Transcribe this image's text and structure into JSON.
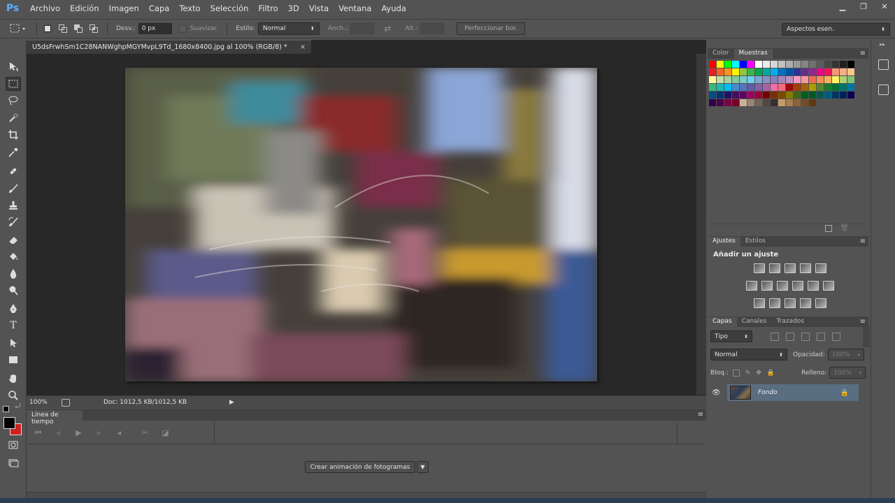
{
  "app": {
    "logo": "Ps"
  },
  "menu": [
    "Archivo",
    "Edición",
    "Imagen",
    "Capa",
    "Texto",
    "Selección",
    "Filtro",
    "3D",
    "Vista",
    "Ventana",
    "Ayuda"
  ],
  "window_controls": {
    "minimize": "▁",
    "restore": "❐",
    "close": "✕"
  },
  "options": {
    "feather_label": "Desv.:",
    "feather_value": "0 px",
    "antialias_label": "Suavizar",
    "style_label": "Estilo:",
    "style_value": "Normal",
    "width_label": "Anch.:",
    "height_label": "Alt.:",
    "refine_button": "Perfeccionar bor.",
    "workspace": "Aspectos esen."
  },
  "document": {
    "tab_title": "U5dsFrwhSm1C28NANWghpMGYMvpL9Td_1680x8400.jpg al 100% (RGB/8) *",
    "tab_close": "×"
  },
  "status": {
    "zoom": "100%",
    "doc_info": "Doc: 1012,5 KB/1012,5 KB",
    "arrow": "▶"
  },
  "timeline": {
    "tab": "Línea de tiempo",
    "create_button": "Crear animación de fotogramas",
    "menu": "≡",
    "dropdown_glyph": "▼"
  },
  "panels": {
    "color_tabs": [
      "Color",
      "Muestras"
    ],
    "adjust_tabs": [
      "Ajustes",
      "Estilos"
    ],
    "adjust_title": "Añadir un ajuste",
    "layers_tabs": [
      "Capas",
      "Canales",
      "Trazados"
    ],
    "kind_filter": "Tipo",
    "blend_mode": "Normal",
    "opacity_label": "Opacidad:",
    "opacity_value": "100%",
    "lock_label": "Bloq.:",
    "fill_label": "Relleno:",
    "fill_value": "100%",
    "layer_name": "Fondo",
    "menu": "≡"
  },
  "colors": {
    "ui_bg": "#535353",
    "canvas_bg": "#282828",
    "layer_selected": "#5a6e82",
    "foreground": "#000000",
    "background": "#d0201e"
  },
  "swatches": [
    "#ff0000",
    "#ffff00",
    "#00ff00",
    "#00ffff",
    "#0000ff",
    "#ff00ff",
    "#ffffff",
    "#ebebeb",
    "#d6d6d6",
    "#c2c2c2",
    "#adadad",
    "#999999",
    "#858585",
    "#707070",
    "#5c5c5c",
    "#474747",
    "#333333",
    "#1f1f1f",
    "#000000",
    "#ed1c24",
    "#f26522",
    "#f7941d",
    "#fff200",
    "#8dc63f",
    "#39b54a",
    "#00a651",
    "#00a99d",
    "#00aeef",
    "#0072bc",
    "#0054a6",
    "#2e3192",
    "#662d91",
    "#92278f",
    "#ec008c",
    "#ed145b",
    "#f69679",
    "#f9ad81",
    "#fdc689",
    "#fff799",
    "#c4df9b",
    "#a3d39c",
    "#82ca9c",
    "#7accc8",
    "#6dcff6",
    "#7da7d9",
    "#8393ca",
    "#8781bd",
    "#a187be",
    "#bc8dbf",
    "#f49ac2",
    "#f6989d",
    "#f26c4f",
    "#f68e56",
    "#fbaf5d",
    "#fff467",
    "#acd372",
    "#7cc576",
    "#3bb878",
    "#1abbb4",
    "#00bff3",
    "#438ccb",
    "#5574b9",
    "#605ca8",
    "#855fa8",
    "#a763a8",
    "#f06ea9",
    "#f26d7d",
    "#9e0b0f",
    "#a0410d",
    "#a36209",
    "#aba000",
    "#598527",
    "#1a7b30",
    "#007236",
    "#00746b",
    "#0076a3",
    "#004b80",
    "#003471",
    "#1b1464",
    "#440e62",
    "#630460",
    "#9e005d",
    "#9e0039",
    "#790000",
    "#7b2e00",
    "#7d4900",
    "#827b00",
    "#406618",
    "#005e20",
    "#005826",
    "#005952",
    "#005b7f",
    "#003663",
    "#002157",
    "#0d004c",
    "#32004b",
    "#4b0049",
    "#7b0046",
    "#7a0026",
    "#c7b299",
    "#998675",
    "#736357",
    "#534741",
    "#362f2d",
    "#c69c6d",
    "#a67c52",
    "#8c6239",
    "#754c24",
    "#603913"
  ]
}
